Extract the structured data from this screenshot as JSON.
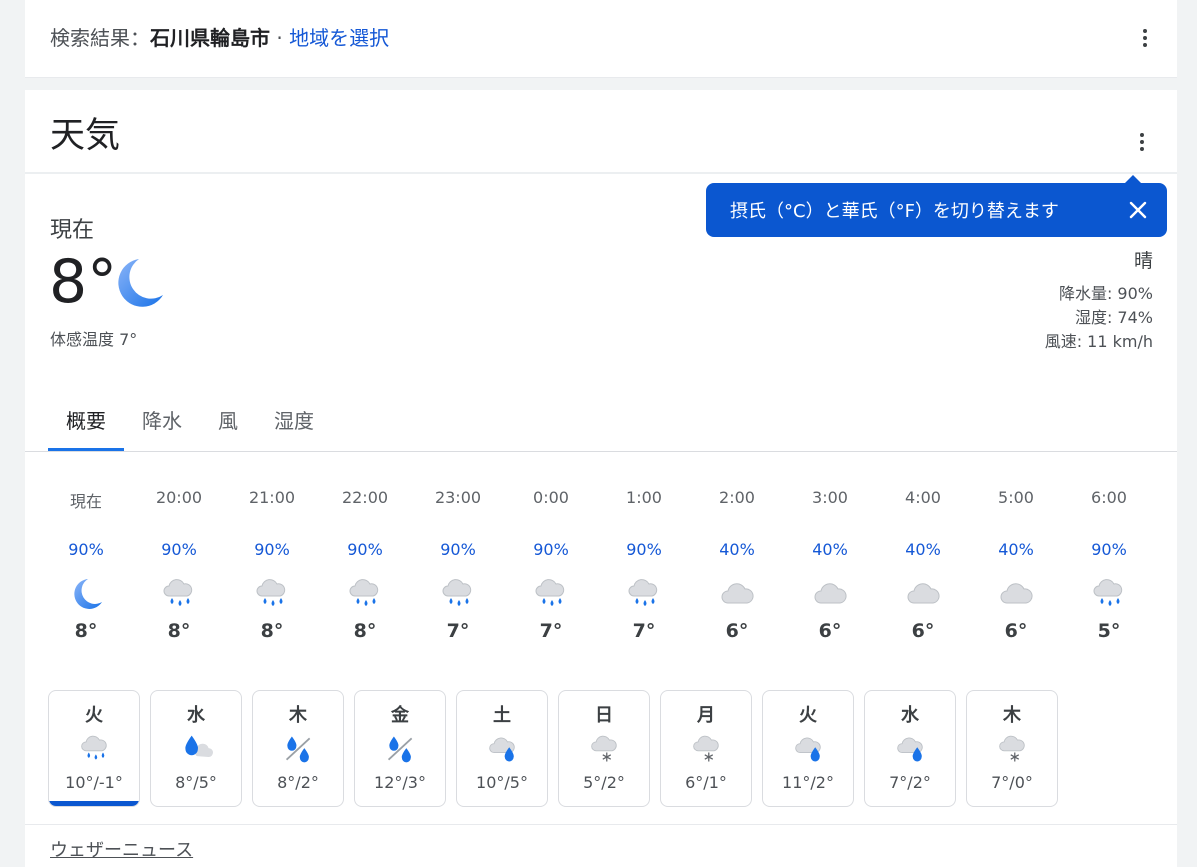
{
  "search": {
    "prefix": "検索結果：",
    "location": "石川県輪島市",
    "separator": " · ",
    "change_region": "地域を選択"
  },
  "weather": {
    "title": "天気",
    "now_label": "現在",
    "current_temp": "8°",
    "current_icon": "moon-icon",
    "feels_like": "体感温度 7°",
    "condition": "晴",
    "precipitation": "降水量: 90%",
    "humidity": "湿度: 74%",
    "wind": "風速: 11 km/h",
    "tooltip": "摂氏（°C）と華氏（°F）を切り替えます",
    "tabs": [
      "概要",
      "降水",
      "風",
      "湿度"
    ],
    "active_tab": 0,
    "hourly": [
      {
        "time": "現在",
        "precip": "90%",
        "icon": "moon-icon",
        "temp": "8°"
      },
      {
        "time": "20:00",
        "precip": "90%",
        "icon": "rain-cloud-icon",
        "temp": "8°"
      },
      {
        "time": "21:00",
        "precip": "90%",
        "icon": "rain-cloud-icon",
        "temp": "8°"
      },
      {
        "time": "22:00",
        "precip": "90%",
        "icon": "rain-cloud-icon",
        "temp": "8°"
      },
      {
        "time": "23:00",
        "precip": "90%",
        "icon": "rain-cloud-icon",
        "temp": "7°"
      },
      {
        "time": "0:00",
        "precip": "90%",
        "icon": "rain-cloud-icon",
        "temp": "7°"
      },
      {
        "time": "1:00",
        "precip": "90%",
        "icon": "rain-cloud-icon",
        "temp": "7°"
      },
      {
        "time": "2:00",
        "precip": "40%",
        "icon": "cloud-icon",
        "temp": "6°"
      },
      {
        "time": "3:00",
        "precip": "40%",
        "icon": "cloud-icon",
        "temp": "6°"
      },
      {
        "time": "4:00",
        "precip": "40%",
        "icon": "cloud-icon",
        "temp": "6°"
      },
      {
        "time": "5:00",
        "precip": "40%",
        "icon": "cloud-icon",
        "temp": "6°"
      },
      {
        "time": "6:00",
        "precip": "90%",
        "icon": "rain-cloud-icon",
        "temp": "5°"
      }
    ],
    "daily": [
      {
        "day": "火",
        "icon": "rain-cloud-icon",
        "temps": "10°/-1°"
      },
      {
        "day": "水",
        "icon": "rain-drop-cloud-icon",
        "temps": "8°/5°"
      },
      {
        "day": "木",
        "icon": "rain-drop-percent-icon",
        "temps": "8°/2°"
      },
      {
        "day": "金",
        "icon": "rain-drop-percent-icon",
        "temps": "12°/3°"
      },
      {
        "day": "土",
        "icon": "cloud-drop-icon",
        "temps": "10°/5°"
      },
      {
        "day": "日",
        "icon": "snow-cloud-icon",
        "temps": "5°/2°"
      },
      {
        "day": "月",
        "icon": "snow-cloud-icon",
        "temps": "6°/1°"
      },
      {
        "day": "火",
        "icon": "cloud-drop-icon",
        "temps": "11°/2°"
      },
      {
        "day": "水",
        "icon": "cloud-drop-icon",
        "temps": "7°/2°"
      },
      {
        "day": "木",
        "icon": "snow-cloud-icon",
        "temps": "7°/0°"
      }
    ],
    "active_day": 0,
    "news_link": "ウェザーニュース"
  }
}
